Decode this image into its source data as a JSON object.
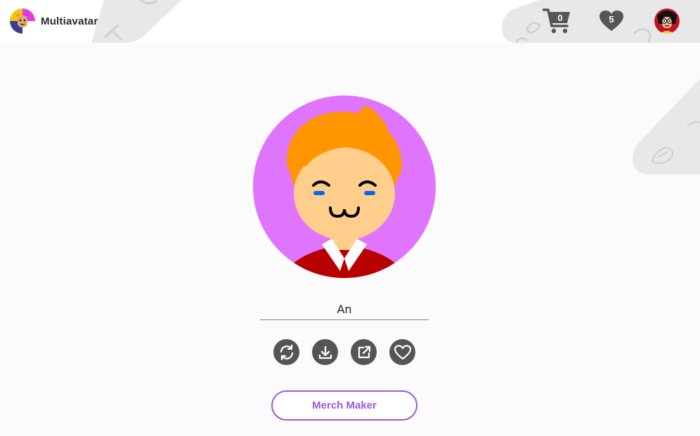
{
  "header": {
    "brand_name": "Multiavatar",
    "cart_count": "0",
    "favorites_count": "5"
  },
  "avatar": {
    "name": "An"
  },
  "actions": [
    {
      "name": "refresh-icon"
    },
    {
      "name": "download-icon"
    },
    {
      "name": "open-external-icon"
    },
    {
      "name": "heart-icon"
    }
  ],
  "merch_button_label": "Merch Maker",
  "colors": {
    "accent": "#9b59d8",
    "avatar_background": "#df75fd",
    "hair": "#ff9500",
    "skin": "#ffce8c",
    "shirt": "#b80000",
    "eyes": "#006be6",
    "icon_dark": "#555555"
  }
}
